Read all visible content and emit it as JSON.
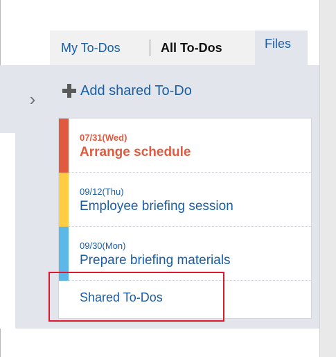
{
  "tabs": {
    "my_todos": "My To-Dos",
    "all_todos": "All To-Dos",
    "files": "Files"
  },
  "toolbar": {
    "add_shared_label": "Add shared To-Do",
    "collapse_icon": "chevron-right-icon",
    "add_icon": "plus-icon"
  },
  "todos": [
    {
      "date": "07/31(Wed)",
      "title": "Arrange schedule",
      "status_color": "#e05a3f",
      "bar_color": "#e05a3f"
    },
    {
      "date": "09/12(Thu)",
      "title": "Employee briefing session",
      "status_color": "#1a5ea6",
      "bar_color": "#ffcc44"
    },
    {
      "date": "09/30(Mon)",
      "title": "Prepare briefing materials",
      "status_color": "#1a5ea6",
      "bar_color": "#5bb8e8"
    }
  ],
  "links": {
    "shared_todos": "Shared To-Dos"
  },
  "colors": {
    "accent": "#1a5ea6",
    "overdue": "#e05a3f",
    "highlight": "#e0182e",
    "panel": "#e2e6ec"
  }
}
